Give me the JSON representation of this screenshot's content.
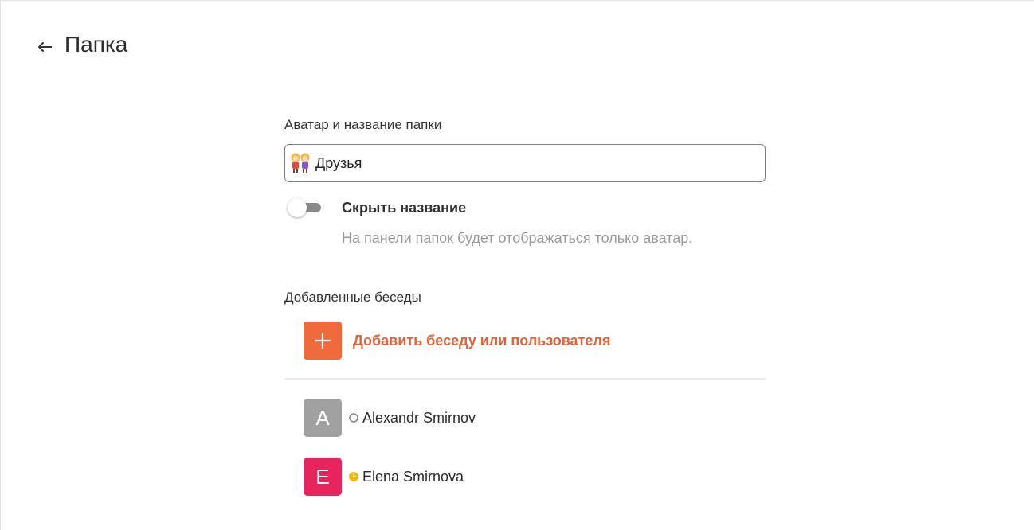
{
  "header": {
    "back_icon": "back-arrow-icon",
    "title": "Папка"
  },
  "folder": {
    "avatar_section_label": "Аватар и название папки",
    "avatar_icon": "two-women-emoji-icon",
    "name_value": "Друзья",
    "hide_name": {
      "label": "Скрыть название",
      "hint": "На панели папок будет отображаться только аватар.",
      "enabled": false
    }
  },
  "chats": {
    "section_label": "Добавленные беседы",
    "add_label": "Добавить беседу или пользователя",
    "add_icon": "plus-icon",
    "users": [
      {
        "initial": "A",
        "name": "Alexandr Smirnov",
        "status_icon": "offline-circle-icon",
        "avatar_color": "#a0a0a0"
      },
      {
        "initial": "E",
        "name": "Elena Smirnova",
        "status_icon": "away-clock-icon",
        "avatar_color": "#e8245e"
      }
    ]
  },
  "colors": {
    "accent": "#ee6a3a",
    "accent_text": "#e0633a",
    "away": "#f2b705"
  }
}
